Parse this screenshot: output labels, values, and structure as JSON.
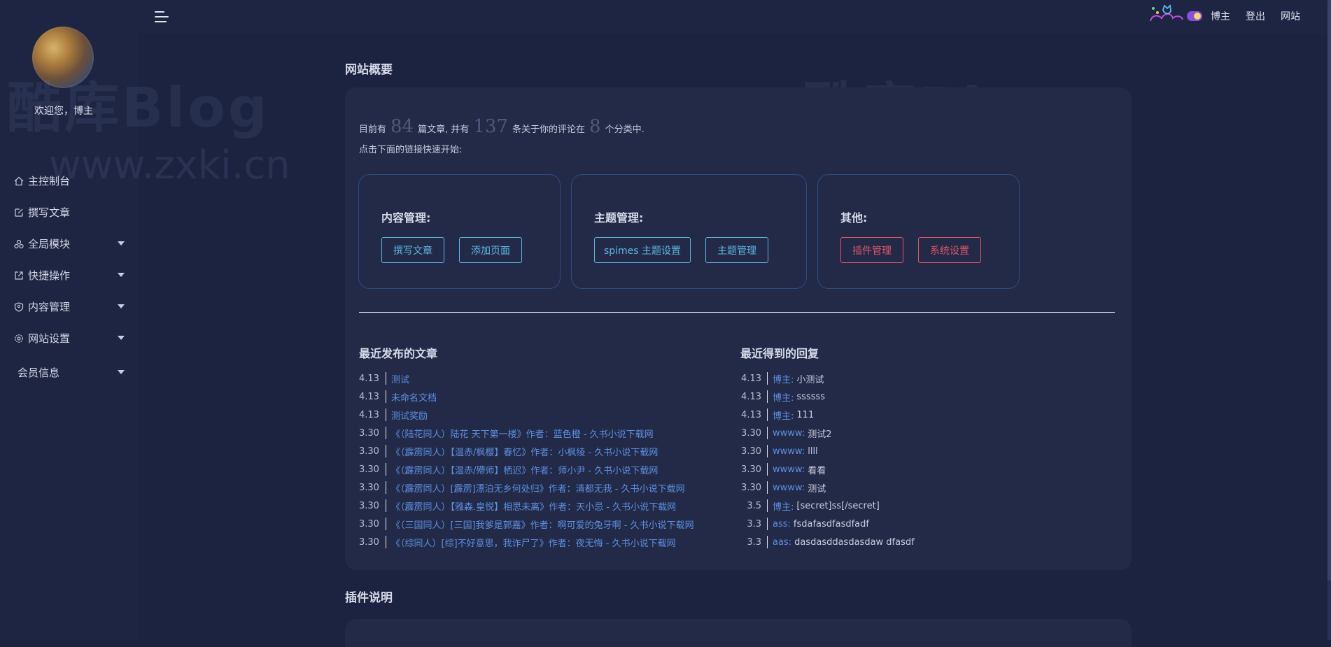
{
  "user": {
    "welcome": "欢迎您，博主"
  },
  "menu": [
    {
      "label": "主控制台",
      "icon": "home-icon",
      "has_submenu": false
    },
    {
      "label": "撰写文章",
      "icon": "edit-icon",
      "has_submenu": false
    },
    {
      "label": "全局模块",
      "icon": "modules-icon",
      "has_submenu": true
    },
    {
      "label": "快捷操作",
      "icon": "external-link-icon",
      "has_submenu": true
    },
    {
      "label": "内容管理",
      "icon": "shield-icon",
      "has_submenu": true
    },
    {
      "label": "网站设置",
      "icon": "gear-icon",
      "has_submenu": true
    },
    {
      "label": "会员信息",
      "icon": "",
      "has_submenu": true
    }
  ],
  "topbar": {
    "links": [
      "博主",
      "登出",
      "网站"
    ]
  },
  "overview": {
    "title": "网站概要",
    "summary_1": "目前有",
    "posts": "84",
    "summary_2": "篇文章, 并有",
    "comments": "137",
    "summary_3": "条关于你的评论在",
    "categories": "8",
    "summary_4": "个分类中.",
    "hint": "点击下面的链接快速开始:"
  },
  "quick": {
    "content": {
      "title": "内容管理:",
      "buttons": [
        "撰写文章",
        "添加页面"
      ]
    },
    "theme": {
      "title": "主题管理:",
      "buttons": [
        "spimes 主题设置",
        "主题管理"
      ]
    },
    "other": {
      "title": "其他:",
      "buttons": [
        "插件管理",
        "系统设置"
      ]
    }
  },
  "recent_posts": {
    "title": "最近发布的文章",
    "items": [
      {
        "date": "4.13",
        "title": "测试"
      },
      {
        "date": "4.13",
        "title": "未命名文档"
      },
      {
        "date": "4.13",
        "title": "测试奖励"
      },
      {
        "date": "3.30",
        "title": "《（陆花同人）陆花 天下第一楼》作者：蓝色橙 - 久书小说下载网"
      },
      {
        "date": "3.30",
        "title": "《（霹雳同人）【温赤/枫樱】春忆》作者：小枫绫 - 久书小说下载网"
      },
      {
        "date": "3.30",
        "title": "《（霹雳同人）【温赤/殢师】栖迟》作者：师小尹 - 久书小说下载网"
      },
      {
        "date": "3.30",
        "title": "《（霹雳同人）[霹雳]漂泊无乡何处归》作者：清都无我 - 久书小说下载网"
      },
      {
        "date": "3.30",
        "title": "《（霹雳同人）【雅森.皇悦】相思未离》作者：天小忌 - 久书小说下载网"
      },
      {
        "date": "3.30",
        "title": "《（三国同人）[三国]我爹是郭嘉》作者：啊可爱的兔牙啊 - 久书小说下载网"
      },
      {
        "date": "3.30",
        "title": "《（综同人）[综]不好意思，我诈尸了》作者：夜无悔 - 久书小说下载网"
      }
    ]
  },
  "recent_replies": {
    "title": "最近得到的回复",
    "items": [
      {
        "date": "4.13",
        "author": "博主",
        "text": "小测试"
      },
      {
        "date": "4.13",
        "author": "博主",
        "text": "ssssss"
      },
      {
        "date": "4.13",
        "author": "博主",
        "text": "111"
      },
      {
        "date": "3.30",
        "author": "wwww",
        "text": "测试2"
      },
      {
        "date": "3.30",
        "author": "wwww",
        "text": "llll"
      },
      {
        "date": "3.30",
        "author": "wwww",
        "text": "看看"
      },
      {
        "date": "3.30",
        "author": "wwww",
        "text": "测试"
      },
      {
        "date": "3.5",
        "author": "博主",
        "text": "[secret]ss[/secret]"
      },
      {
        "date": "3.3",
        "author": "ass",
        "text": "fsdafasdfasdfadf"
      },
      {
        "date": "3.3",
        "author": "aas",
        "text": "dasdasddasdasdaw dfasdf"
      }
    ]
  },
  "plugin_section": {
    "title": "插件说明"
  },
  "watermark": {
    "cn": "酷库Blog",
    "url": "www.zxki.cn"
  },
  "colors": {
    "accent_blue": "#5fb5de",
    "accent_red": "#e05569",
    "link": "#5e8fe0",
    "bg": "#1c2340"
  }
}
